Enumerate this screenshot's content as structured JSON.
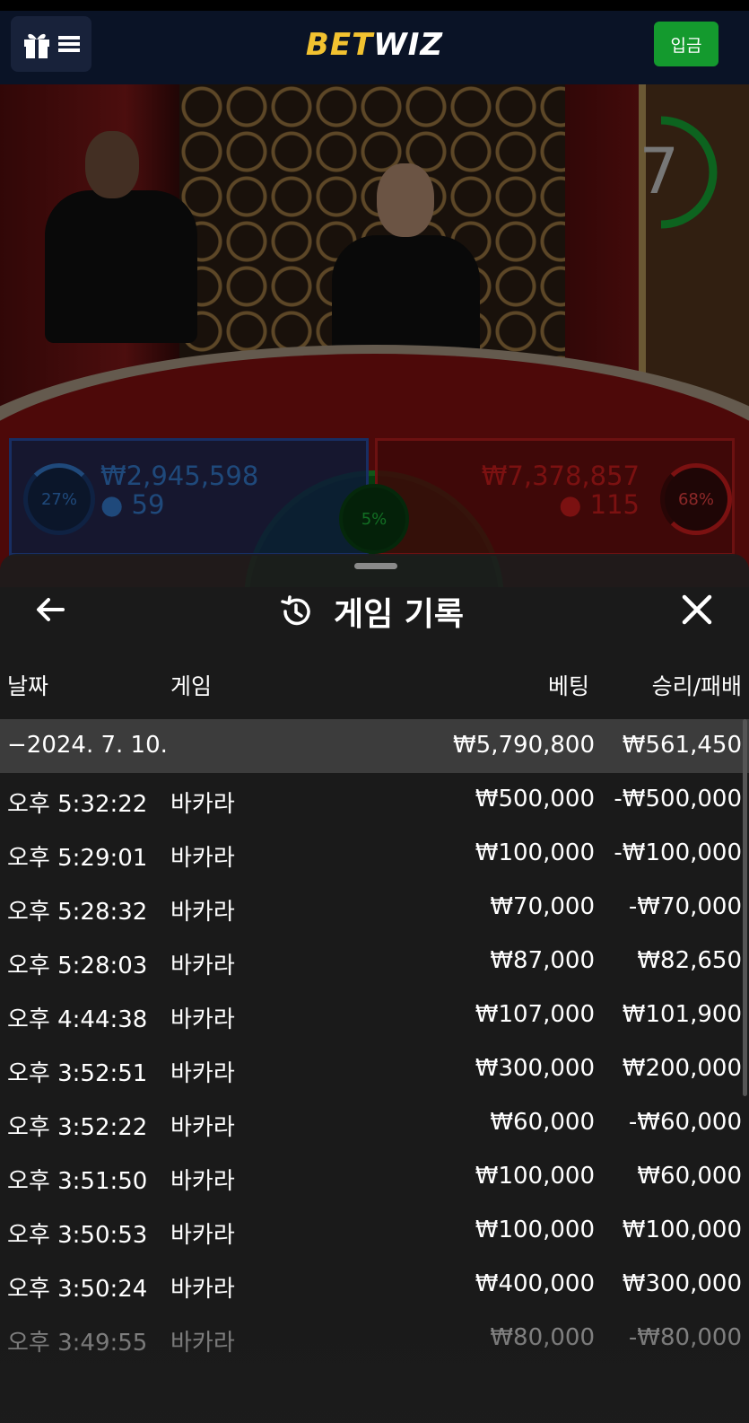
{
  "header": {
    "logo_bet": "BET",
    "logo_wiz": "WIZ",
    "deposit_label": "입금"
  },
  "game": {
    "timer": "7",
    "player": {
      "percent": "27%",
      "amount": "₩2,945,598",
      "count": "59"
    },
    "banker": {
      "percent": "68%",
      "amount": "₩7,378,857",
      "count": "115"
    },
    "tie": {
      "percent": "5%"
    }
  },
  "history": {
    "title": "게임 기록",
    "columns": {
      "date": "날짜",
      "game": "게임",
      "bet": "베팅",
      "winloss": "승리/패배"
    },
    "date_group": {
      "date": "−2024. 7. 10.",
      "bet": "₩5,790,800",
      "winloss": "₩561,450"
    },
    "rows": [
      {
        "time": "오후 5:32:22",
        "game": "바카라",
        "bet": "₩500,000",
        "winloss": "-₩500,000"
      },
      {
        "time": "오후 5:29:01",
        "game": "바카라",
        "bet": "₩100,000",
        "winloss": "-₩100,000"
      },
      {
        "time": "오후 5:28:32",
        "game": "바카라",
        "bet": "₩70,000",
        "winloss": "-₩70,000"
      },
      {
        "time": "오후 5:28:03",
        "game": "바카라",
        "bet": "₩87,000",
        "winloss": "₩82,650"
      },
      {
        "time": "오후 4:44:38",
        "game": "바카라",
        "bet": "₩107,000",
        "winloss": "₩101,900"
      },
      {
        "time": "오후 3:52:51",
        "game": "바카라",
        "bet": "₩300,000",
        "winloss": "₩200,000"
      },
      {
        "time": "오후 3:52:22",
        "game": "바카라",
        "bet": "₩60,000",
        "winloss": "-₩60,000"
      },
      {
        "time": "오후 3:51:50",
        "game": "바카라",
        "bet": "₩100,000",
        "winloss": "₩60,000"
      },
      {
        "time": "오후 3:50:53",
        "game": "바카라",
        "bet": "₩100,000",
        "winloss": "₩100,000"
      },
      {
        "time": "오후 3:50:24",
        "game": "바카라",
        "bet": "₩400,000",
        "winloss": "₩300,000"
      },
      {
        "time": "오후 3:49:55",
        "game": "바카라",
        "bet": "₩80,000",
        "winloss": "-₩80,000"
      }
    ]
  },
  "colors": {
    "brand_yellow": "#f2c230",
    "deposit_green": "#149a2e",
    "player_blue": "#3a86e0",
    "banker_red": "#e02020",
    "tie_green": "#22c840"
  }
}
